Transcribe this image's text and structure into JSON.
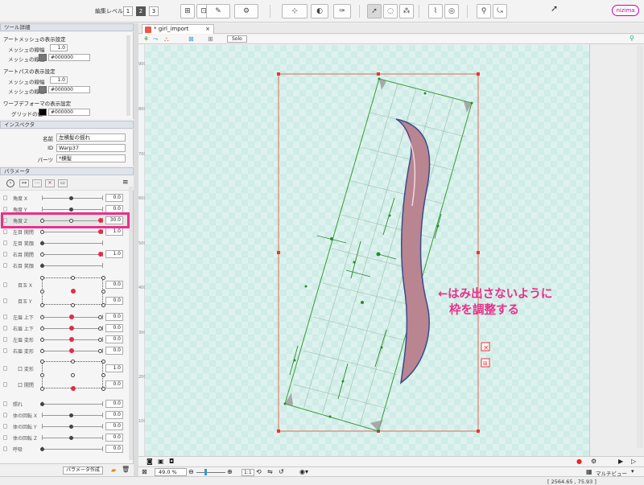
{
  "toolbar": {
    "edit_level_label": "編集レベル",
    "levels": [
      "1",
      "2",
      "3"
    ],
    "selected_level": "2",
    "logo": "nizima"
  },
  "tool_details": {
    "header": "ツール詳細",
    "art_mesh": {
      "title": "アートメッシュの表示設定",
      "width_label": "メッシュの線幅",
      "width_value": "1.0",
      "color_label": "メッシュの線色",
      "color_value": "#000000"
    },
    "art_path": {
      "title": "アートパスの表示設定",
      "width_label": "メッシュの線幅",
      "width_value": "1.0",
      "color_label": "メッシュの線色",
      "color_value": "#000000"
    },
    "warp": {
      "title": "ワープデフォーマの表示設定",
      "grid_label": "グリッドの色",
      "grid_value": "#000000"
    }
  },
  "inspector": {
    "header": "インスペクタ",
    "name_label": "名前",
    "name_value": "左横髪の揺れ",
    "id_label": "ID",
    "id_value": "Warp37",
    "parts_label": "パーツ",
    "parts_value": "*横髪"
  },
  "parameters": {
    "header": "パラメータ",
    "rows": [
      {
        "name": "角度 X",
        "value": "0.0"
      },
      {
        "name": "角度 Y",
        "value": "0.0"
      },
      {
        "name": "角度 Z",
        "value": "30.0"
      },
      {
        "name": "左目 開閉",
        "value": "1.0"
      },
      {
        "name": "左目 笑顔",
        "value": ""
      },
      {
        "name": "右目 開閉",
        "value": "1.0"
      },
      {
        "name": "右目 笑顔",
        "value": ""
      },
      {
        "name": "目玉 X",
        "value": "0.0"
      },
      {
        "name": "目玉 Y",
        "value": "0.0"
      },
      {
        "name": "左眉 上下",
        "value": "0.0"
      },
      {
        "name": "右眉 上下",
        "value": "0.0"
      },
      {
        "name": "左眉 変形",
        "value": "0.0"
      },
      {
        "name": "右眉 変形",
        "value": "0.0"
      },
      {
        "name": "口 変形",
        "value": "1.0"
      },
      {
        "name": "口 開閉",
        "value": "0.0"
      },
      {
        "name": "照れ",
        "value": "0.0"
      },
      {
        "name": "体の回転 X",
        "value": "0.0"
      },
      {
        "name": "体の回転 Y",
        "value": "0.0"
      },
      {
        "name": "体の回転 Z",
        "value": "0.0"
      },
      {
        "name": "呼吸",
        "value": "0.0"
      }
    ],
    "create_button": "パラメータ作成"
  },
  "document": {
    "tab_title": "* girl_import",
    "solo_label": "Solo"
  },
  "ruler": {
    "ticks": [
      "900",
      "800",
      "700",
      "600",
      "500",
      "400",
      "300",
      "200",
      "100"
    ]
  },
  "annotation": {
    "line1": "←はみ出さないように",
    "line2": "枠を調整する"
  },
  "status": {
    "zoom": "49.0 %",
    "ratio": "1:1",
    "multi_view": "マルチビュー",
    "coords": "[ 2564.65 ,   75.93 ]"
  }
}
